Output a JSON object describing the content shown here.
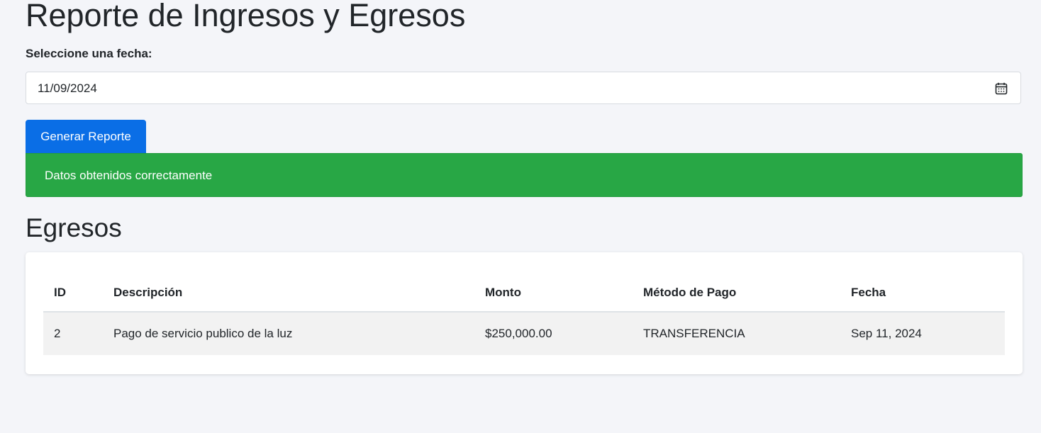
{
  "page": {
    "title": "Reporte de Ingresos y Egresos"
  },
  "filter": {
    "label": "Seleccione una fecha:",
    "date_value": "11/09/2024",
    "calendar_icon": "calendar-icon"
  },
  "actions": {
    "generate_label": "Generar Reporte"
  },
  "alert": {
    "message": "Datos obtenidos correctamente",
    "color": "#28a745"
  },
  "expenses": {
    "heading": "Egresos",
    "columns": [
      "ID",
      "Descripción",
      "Monto",
      "Método de Pago",
      "Fecha"
    ],
    "rows": [
      {
        "id": "2",
        "description": "Pago de servicio publico de la luz",
        "amount": "$250,000.00",
        "payment_method": "TRANSFERENCIA",
        "date": "Sep 11, 2024"
      }
    ]
  },
  "colors": {
    "background": "#f4f5f9",
    "accent": "#0a6ee6",
    "success": "#28a745"
  }
}
